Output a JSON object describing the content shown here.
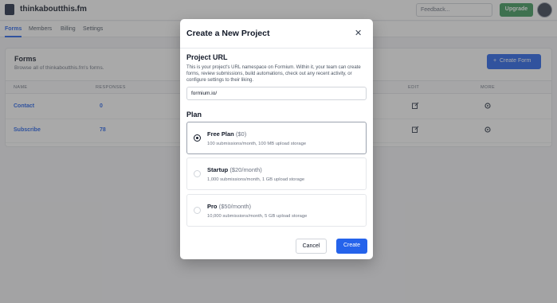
{
  "topbar": {
    "workspace": "thinkaboutthis.fm",
    "chevron": "⌄",
    "feedback_placeholder": "Feedback...",
    "upgrade_label": "Upgrade"
  },
  "nav": {
    "tabs": [
      {
        "label": "Forms"
      },
      {
        "label": "Members"
      },
      {
        "label": "Billing"
      },
      {
        "label": "Settings"
      }
    ]
  },
  "forms_card": {
    "title": "Forms",
    "subtitle": "Browse all of thinkaboutthis.fm's forms.",
    "create_label": "Create Form",
    "create_icon": "+",
    "columns": [
      "NAME",
      "RESPONSES",
      "EDIT",
      "MORE"
    ],
    "rows": [
      {
        "name": "Contact",
        "responses": "0"
      },
      {
        "name": "Subscribe",
        "responses": "78"
      }
    ]
  },
  "modal": {
    "title": "Create a New Project",
    "close_glyph": "✕",
    "url_heading": "Project URL",
    "url_description": "This is your project's URL namespace on Formium. Within it, your team can create forms, review submissions, build automations, check out any recent activity, or configure settings to their liking.",
    "url_value": "formium.io/",
    "plan_heading": "Plan",
    "plans": [
      {
        "name": "Free Plan",
        "price": "($0)",
        "desc": "100 submissions/month, 100 MB upload storage",
        "selected": true
      },
      {
        "name": "Startup",
        "price": "($20/month)",
        "desc": "1,000 submissions/month, 1 GB upload storage",
        "selected": false
      },
      {
        "name": "Pro",
        "price": "($50/month)",
        "desc": "10,000 submissions/month, 5 GB upload storage",
        "selected": false
      }
    ],
    "cancel_label": "Cancel",
    "create_label": "Create"
  },
  "colors": {
    "primary": "#2563eb",
    "upgrade": "#3d9a5b",
    "overlay": "rgba(64,64,64,0.45)"
  }
}
